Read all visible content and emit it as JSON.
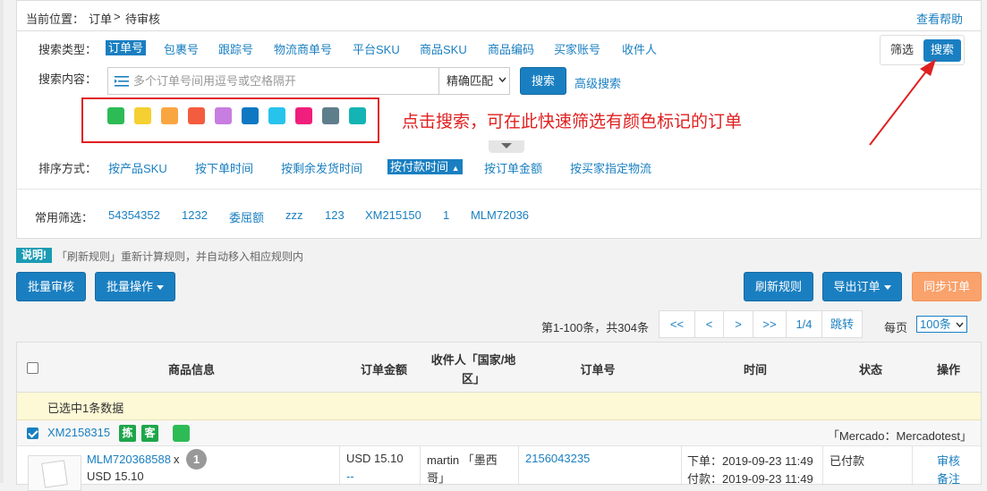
{
  "breadcrumb": {
    "label": "当前位置：",
    "order": "订单",
    "separator": ">",
    "current": "待审核"
  },
  "help_link": "查看帮助",
  "search": {
    "type_label": "搜索类型：",
    "types": [
      "订单号",
      "包裹号",
      "跟踪号",
      "物流商单号",
      "平台SKU",
      "商品SKU",
      "商品编码",
      "买家账号",
      "收件人"
    ],
    "content_label": "搜索内容：",
    "placeholder": "多个订单号间用逗号或空格隔开",
    "match_mode": "精确匹配",
    "search_button": "搜索",
    "advanced_link": "高级搜索",
    "colors": [
      "#2dbb55",
      "#f5d033",
      "#f9a641",
      "#f45c3f",
      "#c77ee0",
      "#0f78c3",
      "#27c3ec",
      "#f01e7c",
      "#5f7e8c",
      "#14b4b4"
    ],
    "annotation": "点击搜索，可在此快速筛选有颜色标记的订单"
  },
  "filter_toggle": {
    "filter": "筛选",
    "search": "搜索"
  },
  "sort": {
    "label": "排序方式：",
    "items": [
      "按产品SKU",
      "按下单时间",
      "按剩余发货时间",
      "按付款时间",
      "按订单金额",
      "按买家指定物流"
    ],
    "active_arrow": "▲"
  },
  "favorites": {
    "label": "常用筛选：",
    "items": [
      "54354352",
      "1232",
      "委屈额",
      "zzz",
      "123",
      "XM215150",
      "1",
      "MLM72036"
    ]
  },
  "note": {
    "badge": "说明!",
    "text": "「刷新规则」重新计算规则，并自动移入相应规则内"
  },
  "toolbar": {
    "bulk_audit": "批量审核",
    "bulk_ops": "批量操作",
    "refresh_rules": "刷新规则",
    "export": "导出订单",
    "sync": "同步订单"
  },
  "pagination": {
    "summary": "第1-100条，共304条",
    "first": "<<",
    "prev": "<",
    "next": ">",
    "last": ">>",
    "page": "1/4",
    "jump": "跳转",
    "per_page_label": "每页",
    "per_page": "100条"
  },
  "table": {
    "headers": {
      "product": "商品信息",
      "amount": "订单金额",
      "recipient_line1": "收件人「国家/地",
      "recipient_line2": "区」",
      "order_no": "订单号",
      "time": "时间",
      "status": "状态",
      "action": "操作"
    },
    "selected_text": "已选中1条数据",
    "order": {
      "id": "XM2158315",
      "tag1": "拣",
      "tag2": "客",
      "shop": "「Mercado：Mercadotest」",
      "sku": "MLM720368588",
      "sku_x": "x",
      "qty": "1",
      "price": "USD 15.10",
      "amount": "USD 15.10",
      "amount_sub": "--",
      "buyer": "martin 「墨西哥」",
      "order_no": "2156043235",
      "time_order": "下单：2019-09-23 11:49",
      "time_pay": "付款：2019-09-23 11:49",
      "status": "已付款",
      "action_audit": "审核",
      "action_note": "备注"
    }
  }
}
